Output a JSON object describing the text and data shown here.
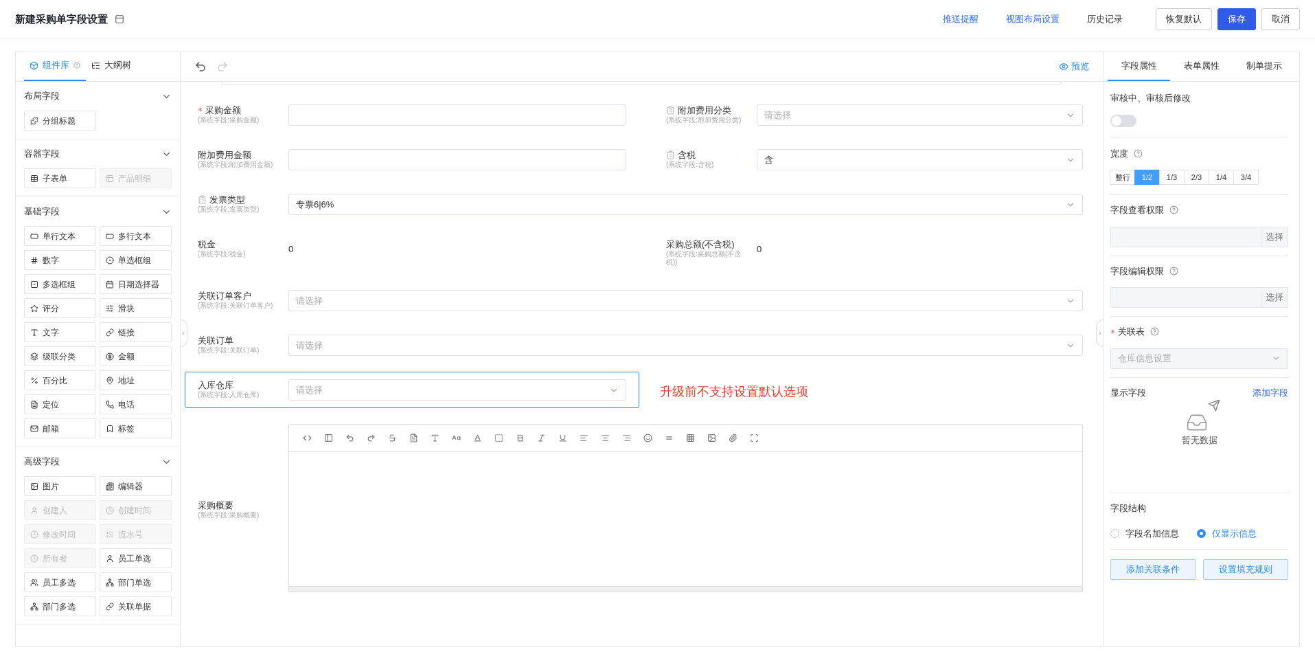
{
  "header": {
    "title": "新建采购单字段设置",
    "links": [
      {
        "label": "推送提醒",
        "kind": "link"
      },
      {
        "label": "视图布局设置",
        "kind": "link"
      },
      {
        "label": "历史记录",
        "kind": "plain"
      }
    ],
    "buttons": [
      {
        "label": "恢复默认",
        "kind": "default"
      },
      {
        "label": "保存",
        "kind": "primary"
      },
      {
        "label": "取消",
        "kind": "default"
      }
    ]
  },
  "left_panel": {
    "tabs": [
      {
        "label": "组件库",
        "selected": true
      },
      {
        "label": "大纲树",
        "selected": false
      }
    ],
    "groups": [
      {
        "title": "布局字段",
        "expanded": true,
        "items": [
          {
            "label": "分组标题",
            "disabled": false
          }
        ]
      },
      {
        "title": "容器字段",
        "expanded": true,
        "items": [
          {
            "label": "子表单",
            "disabled": false
          },
          {
            "label": "产品明细",
            "disabled": true
          }
        ]
      },
      {
        "title": "基础字段",
        "expanded": true,
        "items": [
          {
            "label": "单行文本",
            "disabled": false
          },
          {
            "label": "多行文本",
            "disabled": false
          },
          {
            "label": "数字",
            "disabled": false
          },
          {
            "label": "单选框组",
            "disabled": false
          },
          {
            "label": "多选框组",
            "disabled": false
          },
          {
            "label": "日期选择器",
            "disabled": false
          },
          {
            "label": "评分",
            "disabled": false
          },
          {
            "label": "滑块",
            "disabled": false
          },
          {
            "label": "文字",
            "disabled": false
          },
          {
            "label": "链接",
            "disabled": false
          },
          {
            "label": "级联分类",
            "disabled": false
          },
          {
            "label": "金额",
            "disabled": false
          },
          {
            "label": "百分比",
            "disabled": false
          },
          {
            "label": "地址",
            "disabled": false
          },
          {
            "label": "定位",
            "disabled": false
          },
          {
            "label": "电话",
            "disabled": false
          },
          {
            "label": "邮箱",
            "disabled": false
          },
          {
            "label": "标签",
            "disabled": false
          }
        ]
      },
      {
        "title": "高级字段",
        "expanded": true,
        "items": [
          {
            "label": "图片",
            "disabled": false
          },
          {
            "label": "编辑器",
            "disabled": false
          },
          {
            "label": "创建人",
            "disabled": true
          },
          {
            "label": "创建时间",
            "disabled": true
          },
          {
            "label": "修改时间",
            "disabled": true
          },
          {
            "label": "流水号",
            "disabled": true
          },
          {
            "label": "所有者",
            "disabled": true
          },
          {
            "label": "员工单选",
            "disabled": false
          },
          {
            "label": "员工多选",
            "disabled": false
          },
          {
            "label": "部门单选",
            "disabled": false
          },
          {
            "label": "部门多选",
            "disabled": false
          },
          {
            "label": "关联单据",
            "disabled": false
          }
        ]
      }
    ]
  },
  "canvas": {
    "preview": "预览",
    "rows": [
      {
        "fields": [
          {
            "label": "采购金额",
            "note": "(系统字段:采购金额)",
            "kind": "input",
            "required": true,
            "locked": false,
            "selected": false
          },
          {
            "label": "附加费用分类",
            "note": "(系统字段:附加费用分类)",
            "kind": "select",
            "required": false,
            "locked": true,
            "selected": false,
            "placeholder": "请选择"
          }
        ]
      },
      {
        "fields": [
          {
            "label": "附加费用金额",
            "note": "(系统字段:附加费用金额)",
            "kind": "input",
            "required": false,
            "locked": false,
            "selected": false
          },
          {
            "label": "含税",
            "note": "(系统字段:含税)",
            "kind": "select",
            "required": false,
            "locked": true,
            "selected": false,
            "value": "含"
          }
        ]
      },
      {
        "fields": [
          {
            "label": "发票类型",
            "note": "(系统字段:发票类型)",
            "kind": "select",
            "required": false,
            "locked": true,
            "selected": false,
            "value": "专票6|6%"
          }
        ]
      },
      {
        "fields": [
          {
            "label": "税金",
            "note": "(系统字段:税金)",
            "kind": "value",
            "required": false,
            "locked": false,
            "selected": false,
            "value": "0"
          },
          {
            "label": "采购总额(不含税)",
            "note": "(系统字段:采购总额(不含税))",
            "kind": "value",
            "required": false,
            "locked": false,
            "selected": false,
            "value": "0"
          }
        ]
      },
      {
        "fields": [
          {
            "label": "关联订单客户",
            "note": "(系统字段:关联订单客户)",
            "kind": "select",
            "required": false,
            "locked": false,
            "selected": false,
            "placeholder": "请选择"
          }
        ]
      },
      {
        "fields": [
          {
            "label": "关联订单",
            "note": "(系统字段:关联订单)",
            "kind": "select",
            "required": false,
            "locked": false,
            "selected": false,
            "placeholder": "请选择"
          }
        ]
      },
      {
        "fields": [
          {
            "label": "入库仓库",
            "note": "(系统字段:入库仓库)",
            "kind": "select",
            "required": false,
            "locked": false,
            "selected": true,
            "placeholder": "请选择"
          }
        ],
        "warning": "升级前不支持设置默认选项"
      },
      {
        "fields": [
          {
            "label": "采购概要",
            "note": "(系统字段:采购概要)",
            "kind": "editor",
            "required": false,
            "locked": false,
            "selected": false
          }
        ]
      }
    ]
  },
  "right_panel": {
    "tabs": [
      {
        "label": "字段属性",
        "selected": true
      },
      {
        "label": "表单属性",
        "selected": false
      },
      {
        "label": "制单提示",
        "selected": false
      }
    ],
    "review_edit": {
      "label": "审核中、审核后修改",
      "on": false
    },
    "width": {
      "label": "宽度",
      "options": [
        {
          "label": "整行",
          "selected": false
        },
        {
          "label": "1/2",
          "selected": true
        },
        {
          "label": "1/3",
          "selected": false
        },
        {
          "label": "2/3",
          "selected": false
        },
        {
          "label": "1/4",
          "selected": false
        },
        {
          "label": "3/4",
          "selected": false
        }
      ]
    },
    "view_permission": {
      "label": "字段查看权限",
      "button": "选择"
    },
    "edit_permission": {
      "label": "字段编辑权限",
      "button": "选择"
    },
    "linked_table": {
      "label": "关联表",
      "required": true,
      "disabled": true,
      "value": "仓库信息设置"
    },
    "display_fields": {
      "label": "显示字段",
      "action": "添加字段",
      "empty_text": "暂无数据"
    },
    "structure": {
      "label": "字段结构",
      "options": [
        {
          "label": "字段名加信息",
          "selected": false
        },
        {
          "label": "仅显示信息",
          "selected": true
        }
      ]
    },
    "buttons": [
      "添加关联条件",
      "设置填充规则"
    ]
  }
}
